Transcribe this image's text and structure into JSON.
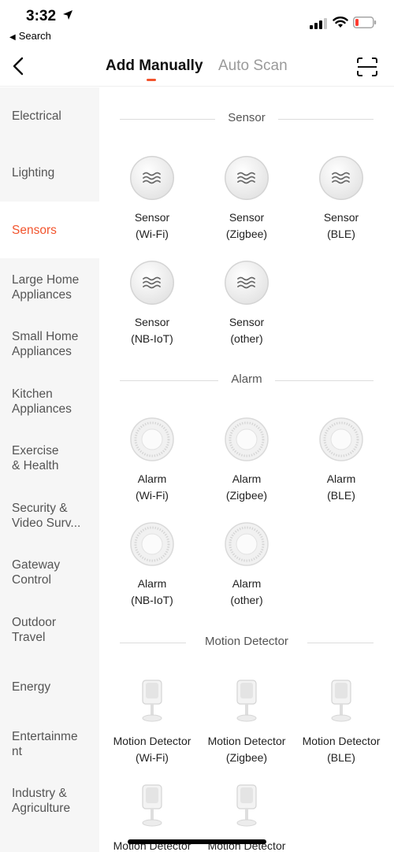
{
  "status_bar": {
    "time": "3:32",
    "back_app_label": "Search"
  },
  "nav": {
    "tabs": [
      "Add Manually",
      "Auto Scan"
    ],
    "active_tab": "Add Manually",
    "accent_color": "#f2542d"
  },
  "sidebar": {
    "items": [
      {
        "label": "Electrical"
      },
      {
        "label": "Lighting"
      },
      {
        "label": "Sensors"
      },
      {
        "label": "Large Home\nAppliances"
      },
      {
        "label": "Small Home\nAppliances"
      },
      {
        "label": "Kitchen\nAppliances"
      },
      {
        "label": "Exercise\n& Health"
      },
      {
        "label": "Security &\nVideo Surv..."
      },
      {
        "label": "Gateway\nControl"
      },
      {
        "label": "Outdoor\nTravel"
      },
      {
        "label": "Energy"
      },
      {
        "label": "Entertainme\nnt"
      },
      {
        "label": "Industry &\nAgriculture"
      }
    ],
    "active_item": "Sensors"
  },
  "sections": [
    {
      "title": "Sensor",
      "icon": "sensor-icon",
      "devices": [
        {
          "name": "Sensor",
          "protocol": "(Wi-Fi)"
        },
        {
          "name": "Sensor",
          "protocol": "(Zigbee)"
        },
        {
          "name": "Sensor",
          "protocol": "(BLE)"
        },
        {
          "name": "Sensor",
          "protocol": "(NB-IoT)"
        },
        {
          "name": "Sensor",
          "protocol": "(other)"
        }
      ]
    },
    {
      "title": "Alarm",
      "icon": "smoke-alarm-icon",
      "devices": [
        {
          "name": "Alarm",
          "protocol": "(Wi-Fi)"
        },
        {
          "name": "Alarm",
          "protocol": "(Zigbee)"
        },
        {
          "name": "Alarm",
          "protocol": "(BLE)"
        },
        {
          "name": "Alarm",
          "protocol": "(NB-IoT)"
        },
        {
          "name": "Alarm",
          "protocol": "(other)"
        }
      ]
    },
    {
      "title": "Motion Detector",
      "icon": "motion-detector-icon",
      "devices": [
        {
          "name": "Motion Detector",
          "protocol": "(Wi-Fi)"
        },
        {
          "name": "Motion Detector",
          "protocol": "(Zigbee)"
        },
        {
          "name": "Motion Detector",
          "protocol": "(BLE)"
        },
        {
          "name": "Motion Detector",
          "protocol": ""
        },
        {
          "name": "Motion Detector",
          "protocol": ""
        }
      ]
    }
  ]
}
